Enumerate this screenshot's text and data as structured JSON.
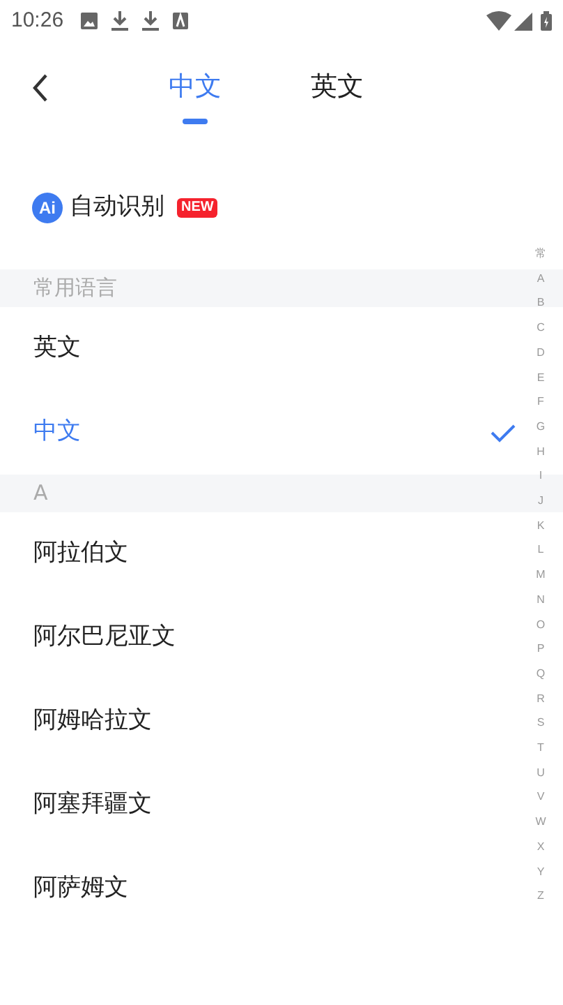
{
  "status_bar": {
    "time": "10:26"
  },
  "tabs": [
    {
      "label": "中文",
      "selected": true
    },
    {
      "label": "英文",
      "selected": false
    }
  ],
  "auto_detect": {
    "icon_text": "Ai",
    "label": "自动识别",
    "badge": "NEW"
  },
  "sections": [
    {
      "header": "常用语言",
      "items": [
        {
          "label": "英文",
          "selected": false
        },
        {
          "label": "中文",
          "selected": true
        }
      ]
    },
    {
      "header": "A",
      "items": [
        {
          "label": "阿拉伯文",
          "selected": false
        },
        {
          "label": "阿尔巴尼亚文",
          "selected": false
        },
        {
          "label": "阿姆哈拉文",
          "selected": false
        },
        {
          "label": "阿塞拜疆文",
          "selected": false
        },
        {
          "label": "阿萨姆文",
          "selected": false
        }
      ]
    }
  ],
  "index": [
    "常",
    "A",
    "B",
    "C",
    "D",
    "E",
    "F",
    "G",
    "H",
    "I",
    "J",
    "K",
    "L",
    "M",
    "N",
    "O",
    "P",
    "Q",
    "R",
    "S",
    "T",
    "U",
    "V",
    "W",
    "X",
    "Y",
    "Z"
  ]
}
